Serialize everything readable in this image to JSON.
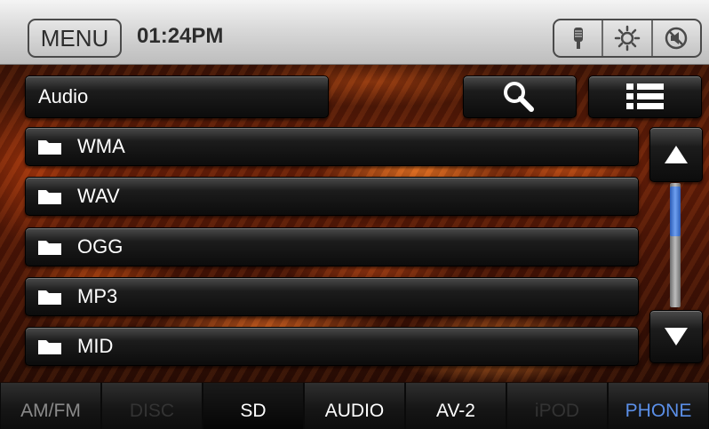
{
  "topbar": {
    "menu_label": "MENU",
    "clock": "01:24PM",
    "icons": [
      "microphone-icon",
      "brightness-icon",
      "mute-icon"
    ]
  },
  "panel": {
    "folder_title": "Audio",
    "search_icon": "search-icon",
    "list_view_icon": "list-view-icon"
  },
  "list": {
    "items": [
      {
        "label": "WMA",
        "icon": "folder-icon"
      },
      {
        "label": "WAV",
        "icon": "folder-icon"
      },
      {
        "label": "OGG",
        "icon": "folder-icon"
      },
      {
        "label": "MP3",
        "icon": "folder-icon"
      },
      {
        "label": "MID",
        "icon": "folder-icon"
      }
    ]
  },
  "scroll": {
    "up_icon": "triangle-up-icon",
    "down_icon": "triangle-down-icon",
    "position": 0.0
  },
  "tabs": [
    {
      "label": "AM/FM",
      "state": "inactive"
    },
    {
      "label": "DISC",
      "state": "disabled"
    },
    {
      "label": "SD",
      "state": "active"
    },
    {
      "label": "AUDIO",
      "state": "normal"
    },
    {
      "label": "AV-2",
      "state": "normal"
    },
    {
      "label": "iPOD",
      "state": "disabled"
    },
    {
      "label": "PHONE",
      "state": "phone"
    }
  ],
  "colors": {
    "accent": "#5b8fe8",
    "scroll_thumb": "#4a7fd6"
  }
}
